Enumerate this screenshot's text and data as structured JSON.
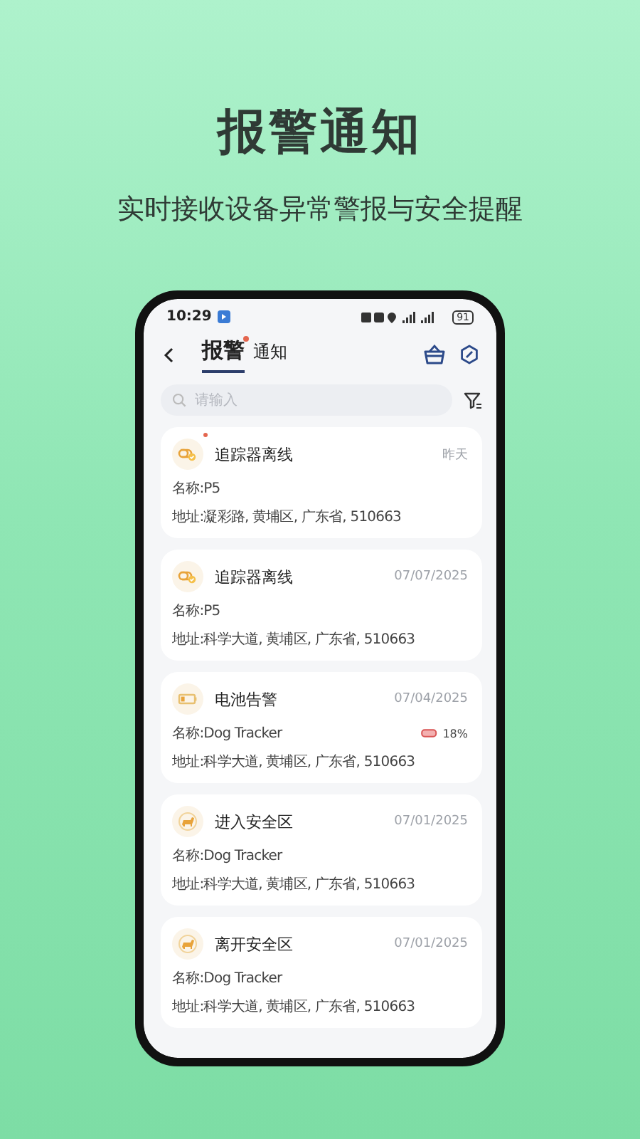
{
  "headline": "报警通知",
  "subtitle": "实时接收设备异常警报与安全提醒",
  "status_bar": {
    "time": "10:29",
    "battery": "91"
  },
  "tabs": [
    {
      "label": "报警",
      "selected": true,
      "badge": true
    },
    {
      "label": "通知",
      "selected": false,
      "badge": false
    }
  ],
  "search": {
    "placeholder": "请输入"
  },
  "alerts": [
    {
      "kind": "offline",
      "title": "追踪器离线",
      "date": "昨天",
      "unread": true,
      "name": "名称:P5",
      "address": "地址:凝彩路, 黄埔区, 广东省, 510663"
    },
    {
      "kind": "offline",
      "title": "追踪器离线",
      "date": "07/07/2025",
      "unread": false,
      "name": "名称:P5",
      "address": "地址:科学大道, 黄埔区, 广东省, 510663"
    },
    {
      "kind": "battery",
      "title": "电池告警",
      "date": "07/04/2025",
      "unread": false,
      "name": "名称:Dog Tracker",
      "battery": "18%",
      "address": "地址:科学大道, 黄埔区, 广东省, 510663"
    },
    {
      "kind": "enter",
      "title": "进入安全区",
      "date": "07/01/2025",
      "unread": false,
      "name": "名称:Dog Tracker",
      "address": "地址:科学大道, 黄埔区, 广东省, 510663"
    },
    {
      "kind": "leave",
      "title": "离开安全区",
      "date": "07/01/2025",
      "unread": false,
      "name": "名称:Dog Tracker",
      "address": "地址:科学大道, 黄埔区, 广东省, 510663"
    }
  ]
}
